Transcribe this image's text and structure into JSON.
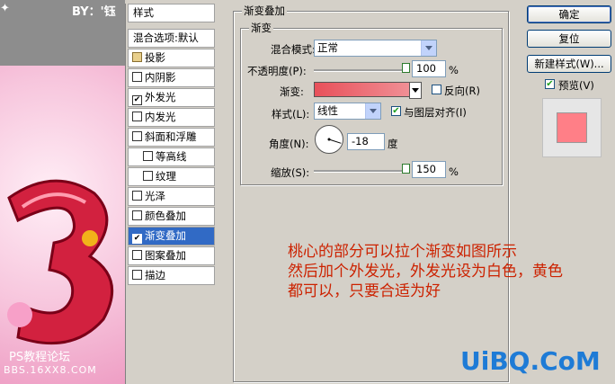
{
  "canvas": {
    "watermark_top": "BY：'钰",
    "watermark_site": "PS教程论坛",
    "watermark_url": "BBS.16XX8.COM"
  },
  "styles_panel": {
    "title": "样式",
    "blend_options": "混合选项:默认",
    "items": [
      {
        "label": "投影",
        "checked": false
      },
      {
        "label": "内阴影",
        "checked": false
      },
      {
        "label": "外发光",
        "checked": true
      },
      {
        "label": "内发光",
        "checked": false
      },
      {
        "label": "斜面和浮雕",
        "checked": false
      },
      {
        "label": "等高线",
        "checked": false
      },
      {
        "label": "纹理",
        "checked": false
      },
      {
        "label": "光泽",
        "checked": false
      },
      {
        "label": "颜色叠加",
        "checked": false
      },
      {
        "label": "渐变叠加",
        "checked": true
      },
      {
        "label": "图案叠加",
        "checked": false
      },
      {
        "label": "描边",
        "checked": false
      }
    ]
  },
  "gradient_overlay": {
    "group_title": "渐变叠加",
    "sub_title": "渐变",
    "blend_mode_label": "混合模式:",
    "blend_mode_value": "正常",
    "opacity_label": "不透明度(P):",
    "opacity_value": "100",
    "opacity_fraction": 1.0,
    "percent": "%",
    "gradient_label": "渐变:",
    "reverse_label": "反向(R)",
    "style_label": "样式(L):",
    "style_value": "线性",
    "align_label": "与图层对齐(I)",
    "angle_label": "角度(N):",
    "angle_value": "-18",
    "angle_unit": "度",
    "scale_label": "缩放(S):",
    "scale_value": "150",
    "scale_fraction": 1.0
  },
  "buttons": {
    "ok": "确定",
    "reset": "复位",
    "new_style": "新建样式(W)...",
    "preview_label": "预览(V)"
  },
  "annotation": {
    "line1": "桃心的部分可以拉个渐变如图所示",
    "line2": "然后加个外发光，外发光设为白色，黄色",
    "line3": "都可以，只要合适为好"
  },
  "logo": "UiBQ.CoM",
  "colors": {
    "accent": "#316ac5",
    "annotation": "#cc2200",
    "gradient_start": "#e8505a",
    "gradient_end": "#f08f95",
    "preview_swatch": "#ff7f87",
    "logo": "#1e7bd6"
  }
}
